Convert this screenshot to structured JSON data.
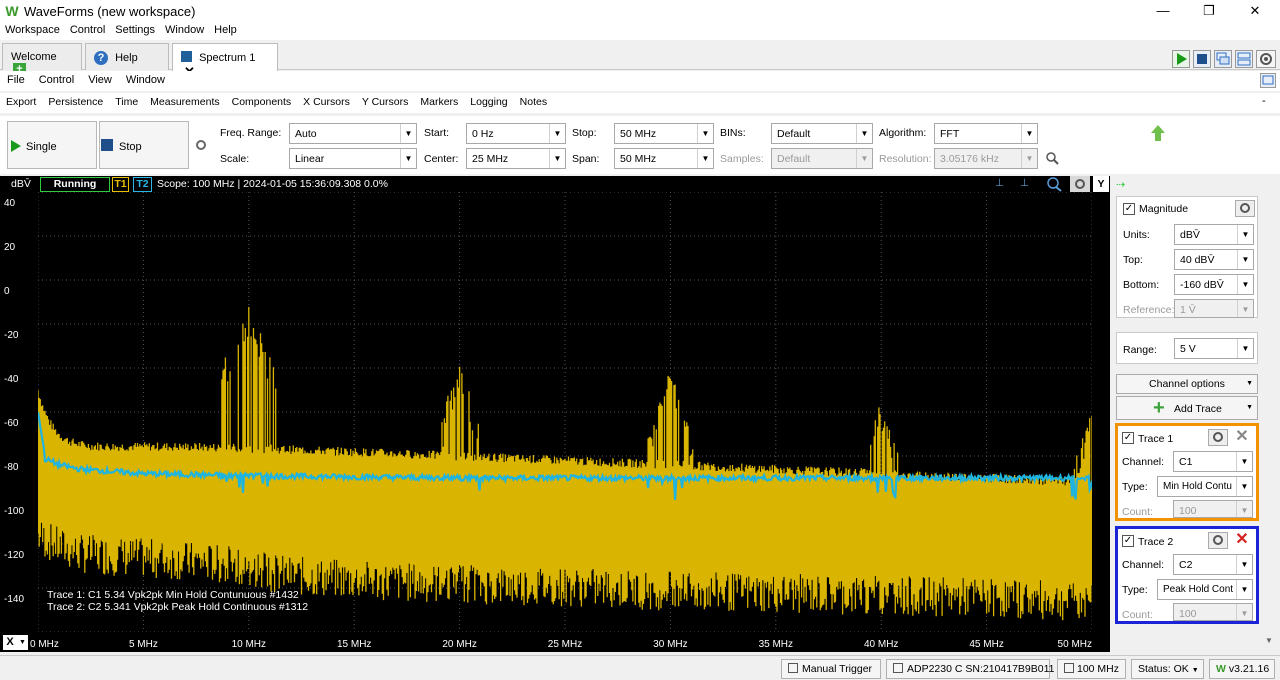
{
  "app": {
    "title": "WaveForms (new workspace)"
  },
  "window_controls": {
    "minimize": "—",
    "maximize": "❐",
    "close": "✕"
  },
  "menu": [
    "Workspace",
    "Control",
    "Settings",
    "Window",
    "Help"
  ],
  "tabs": [
    {
      "label": "Welcome"
    },
    {
      "label": "Help"
    },
    {
      "label": "Spectrum 1"
    }
  ],
  "submenu": [
    "File",
    "Control",
    "View",
    "Window"
  ],
  "toolbar": [
    "Export",
    "Persistence",
    "Time",
    "Measurements",
    "Components",
    "X Cursors",
    "Y Cursors",
    "Markers",
    "Logging",
    "Notes"
  ],
  "toolbar_dash": "-",
  "controls": {
    "single_label": "Single",
    "stop_label": "Stop",
    "freq_range_label": "Freq. Range:",
    "freq_range": "Auto",
    "scale_label": "Scale:",
    "scale": "Linear",
    "start_label": "Start:",
    "start": "0 Hz",
    "center_label": "Center:",
    "center": "25 MHz",
    "stop_freq_label": "Stop:",
    "stop_freq": "50 MHz",
    "span_label": "Span:",
    "span": "50 MHz",
    "bins_label": "BINs:",
    "bins": "Default",
    "samples_label": "Samples:",
    "samples": "Default",
    "algorithm_label": "Algorithm:",
    "algorithm": "FFT",
    "resolution_label": "Resolution:",
    "resolution": "3.05176 kHz"
  },
  "status": {
    "unit": "dBV̄",
    "state": "Running",
    "t1": "T1",
    "t2": "T2",
    "info": "Scope: 100 MHz | 2024-01-05 15:36:09.308 0.0%",
    "y_button": "Y"
  },
  "chart_data": {
    "type": "line",
    "ylabel": "dBV̄",
    "ylim": [
      -160,
      40
    ],
    "xlim": [
      0,
      50
    ],
    "yticks": [
      "40",
      "20",
      "0",
      "-20",
      "-40",
      "-60",
      "-80",
      "-100",
      "-120",
      "-140",
      "-160"
    ],
    "xticks": [
      "0 MHz",
      "5 MHz",
      "10 MHz",
      "15 MHz",
      "20 MHz",
      "25 MHz",
      "30 MHz",
      "35 MHz",
      "40 MHz",
      "45 MHz",
      "50 MHz"
    ],
    "grid": true,
    "series": [
      {
        "name": "Trace 2",
        "color": "#d9b400",
        "x": [
          0,
          1,
          2,
          5,
          8,
          10,
          12,
          15,
          20,
          25,
          30,
          35,
          40,
          45,
          50
        ],
        "peak": [
          -50,
          -58,
          -65,
          -71,
          -74,
          -10,
          -76,
          -80,
          -36,
          -90,
          -38,
          -55,
          -58,
          -75,
          -60
        ],
        "floor": [
          -120,
          -125,
          -128,
          -130,
          -132,
          -135,
          -138,
          -140,
          -142,
          -143,
          -145,
          -146,
          -147,
          -148,
          -150
        ]
      },
      {
        "name": "Trace 1",
        "color": "#1fb4e0",
        "x": [
          0,
          1,
          2,
          5,
          10,
          20,
          30,
          40,
          50
        ],
        "values": [
          -80,
          -84,
          -86,
          -88,
          -89,
          -90,
          -90,
          -90,
          -90
        ]
      }
    ],
    "legend_lines": [
      "Trace 1: C1 5.34 Vpk2pk Min Hold Contunuous #1432",
      "Trace 2: C2 5.341 Vpk2pk Peak Hold Continuous #1312"
    ]
  },
  "x_button": "X",
  "side": {
    "magnitude_label": "Magnitude",
    "units_label": "Units:",
    "units": "dBV̄",
    "top_label": "Top:",
    "top": "40 dBV̄",
    "bottom_label": "Bottom:",
    "bottom": "-160 dBV̄",
    "reference_label": "Reference:",
    "reference": "1 V̄",
    "range_label": "Range:",
    "range": "5 V",
    "channel_options": "Channel options",
    "add_trace": "Add Trace",
    "trace1": {
      "title": "Trace 1",
      "channel_label": "Channel:",
      "channel": "C1",
      "type_label": "Type:",
      "type": "Min Hold Contu",
      "count_label": "Count:",
      "count": "100",
      "border": "#f39200"
    },
    "trace2": {
      "title": "Trace 2",
      "channel_label": "Channel:",
      "channel": "C2",
      "type_label": "Type:",
      "type": "Peak Hold Cont",
      "count_label": "Count:",
      "count": "100",
      "border": "#1a23d6"
    }
  },
  "bottom": {
    "manual_trigger": "Manual Trigger",
    "device": "ADP2230 C SN:210417B9B011",
    "clock": "100 MHz",
    "status": "Status: OK",
    "version": "v3.21.16"
  }
}
